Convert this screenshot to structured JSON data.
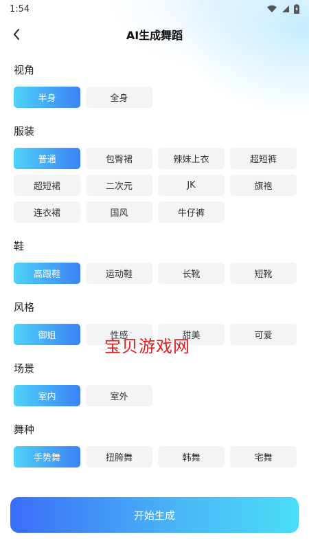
{
  "status_bar": {
    "time": "1:54"
  },
  "header": {
    "title": "AI生成舞蹈"
  },
  "sections": [
    {
      "title": "视角",
      "options": [
        "半身",
        "全身"
      ],
      "selected": 0
    },
    {
      "title": "服装",
      "options": [
        "普通",
        "包臀裙",
        "辣妹上衣",
        "超短裤",
        "超短裙",
        "二次元",
        "JK",
        "旗袍",
        "连衣裙",
        "国风",
        "牛仔裤"
      ],
      "selected": 0
    },
    {
      "title": "鞋",
      "options": [
        "高跟鞋",
        "运动鞋",
        "长靴",
        "短靴"
      ],
      "selected": 0
    },
    {
      "title": "风格",
      "options": [
        "御姐",
        "性感",
        "甜美",
        "可爱"
      ],
      "selected": 0
    },
    {
      "title": "场景",
      "options": [
        "室内",
        "室外"
      ],
      "selected": 0
    },
    {
      "title": "舞种",
      "options": [
        "手势舞",
        "扭胯舞",
        "韩舞",
        "宅舞"
      ],
      "selected": 0
    }
  ],
  "watermark": "宝贝游戏网",
  "start_button": "开始生成",
  "colors": {
    "accent_start": "#4fd2f7",
    "accent_end": "#3b82f6",
    "chip_bg": "#f3f4f6"
  }
}
